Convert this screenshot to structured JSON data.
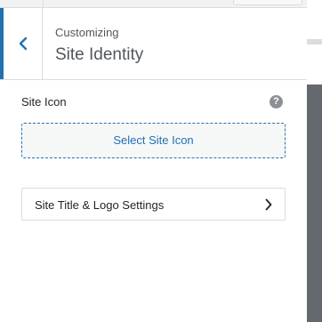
{
  "header": {
    "subtitle": "Customizing",
    "title": "Site Identity"
  },
  "site_icon": {
    "label": "Site Icon",
    "help": "?",
    "select_button_label": "Select Site Icon"
  },
  "logo_settings": {
    "label": "Site Title & Logo Settings"
  },
  "colors": {
    "accent": "#2271b1",
    "text": "#1d2327",
    "muted": "#50575e",
    "border": "#dcdcde"
  },
  "icons": {
    "back": "chevron-left-icon",
    "help": "help-circle-icon",
    "forward": "chevron-right-icon"
  }
}
